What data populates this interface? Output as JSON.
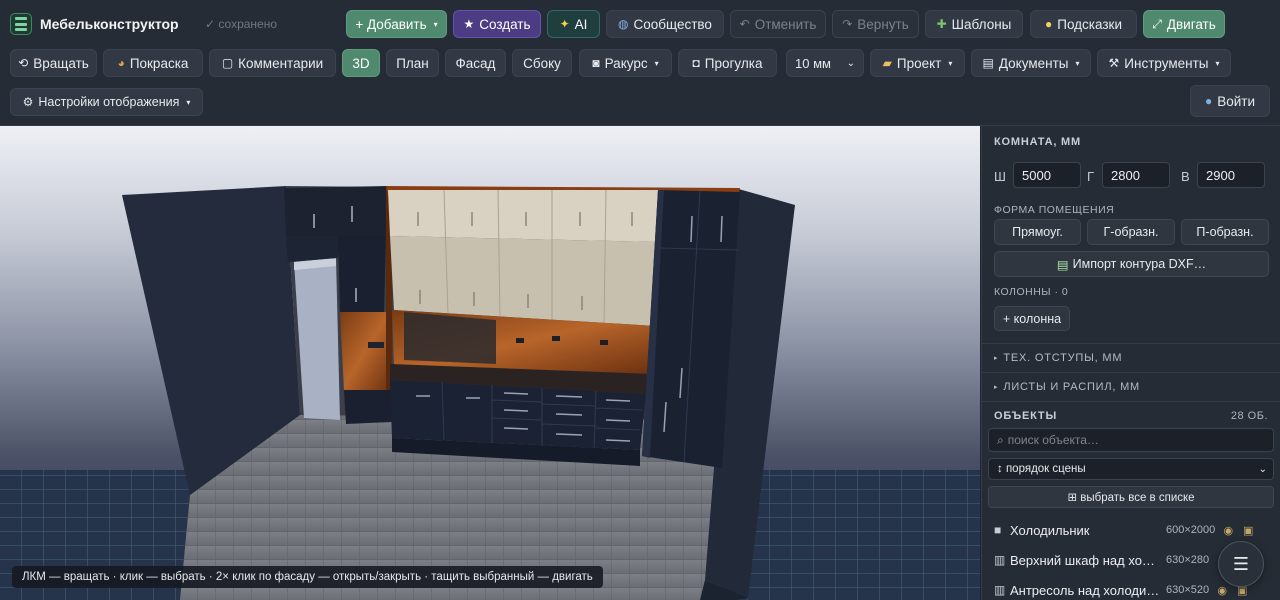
{
  "app": {
    "name": "Мебельконструктор",
    "saved_status": "✓ сохранено"
  },
  "toolbar": {
    "add": "+ Добавить",
    "create": "Создать",
    "ai": "AI",
    "community": "Сообщество",
    "undo": "Отменить",
    "redo": "Вернуть",
    "templates": "Шаблоны",
    "hints": "Подсказки",
    "move": "Двигать",
    "rotate": "Вращать",
    "paint": "Покраска",
    "comments": "Комментарии",
    "view_3d": "3D",
    "view_plan": "План",
    "view_facade": "Фасад",
    "view_side": "Сбоку",
    "camera": "Ракурс",
    "walk": "Прогулка",
    "snap_value": "10 мм",
    "project": "Проект",
    "documents": "Документы",
    "tools": "Инструменты",
    "display_settings": "Настройки отображения",
    "login": "Войти"
  },
  "viewport": {
    "hint": "ЛКМ — вращать · клик — выбрать · 2× клик по фасаду — открыть/закрыть · тащить выбранный — двигать"
  },
  "panel": {
    "room_title": "КОМНАТА, ММ",
    "width_label": "Ш",
    "width_value": "5000",
    "depth_label": "Г",
    "depth_value": "2800",
    "height_label": "В",
    "height_value": "2900",
    "shape_title": "ФОРМА ПОМЕЩЕНИЯ",
    "shape_rect": "Прямоуг.",
    "shape_l": "Г-образн.",
    "shape_u": "П-образн.",
    "import_dxf": "Импорт контура DXF…",
    "columns_label": "КОЛОННЫ · 0",
    "add_column": "+ колонна",
    "tech_offsets": "ТЕХ. ОТСТУПЫ, ММ",
    "sheets": "ЛИСТЫ И РАСПИЛ, ММ",
    "objects_title": "ОБЪЕКТЫ",
    "objects_count": "28 ОБ.",
    "search_placeholder": "поиск объекта…",
    "order": "порядок сцены",
    "select_all": "⊞ выбрать все в списке",
    "objects": [
      {
        "name": "Холодильник",
        "size": "600×2000"
      },
      {
        "name": "Верхний шкаф над хо…",
        "size": "630×280"
      },
      {
        "name": "Антресоль над холоди…",
        "size": "630×520"
      }
    ]
  },
  "colors": {
    "accent_green": "#4f8a6e",
    "accent_purple": "#4b3c84",
    "panel_bg": "#262c35"
  },
  "icons": {
    "create": "star-icon",
    "ai": "sparkles-icon",
    "community": "globe-icon",
    "templates": "puzzle-icon",
    "hints": "lightbulb-icon",
    "camera": "camera-icon",
    "walk": "gamepad-icon",
    "project": "folder-icon",
    "documents": "document-icon",
    "tools": "tools-icon",
    "login": "user-icon",
    "fab": "menu-icon"
  }
}
